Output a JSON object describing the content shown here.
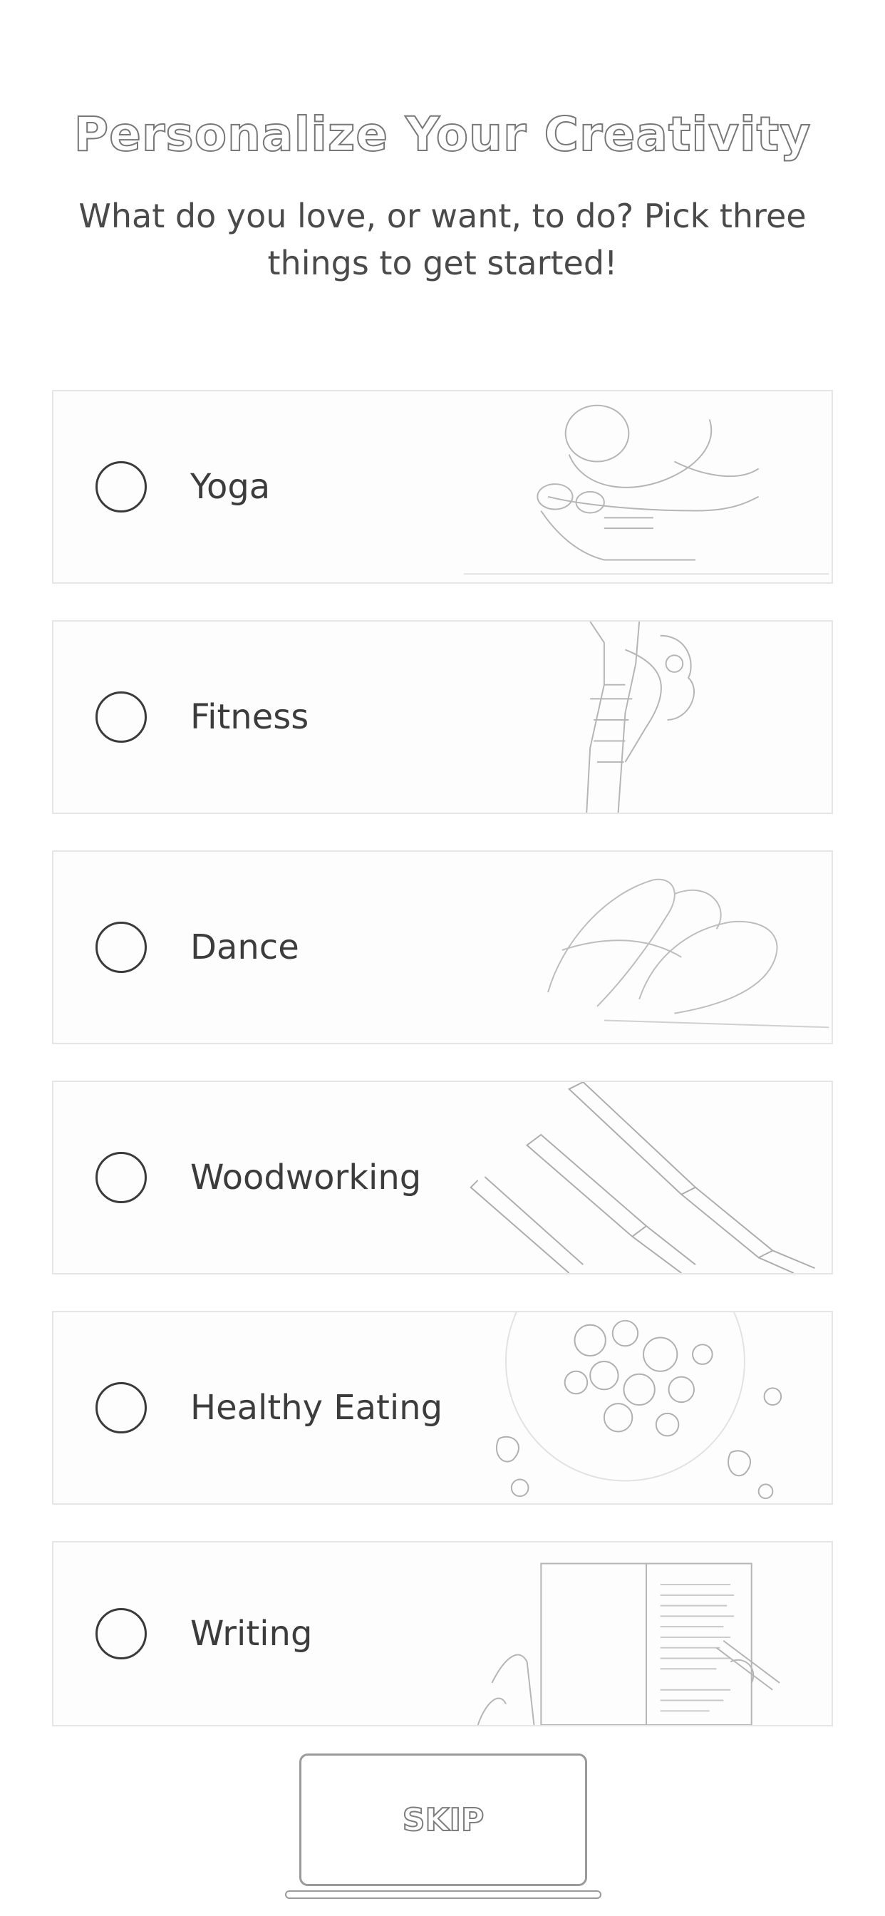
{
  "header": {
    "title": "Personalize Your Creativity",
    "subtitle": "What do you love, or want, to do? Pick three things to get started!"
  },
  "options": [
    {
      "label": "Yoga",
      "selected": false,
      "image_icon": "yoga-pose-photo"
    },
    {
      "label": "Fitness",
      "selected": false,
      "image_icon": "fitness-legs-photo"
    },
    {
      "label": "Dance",
      "selected": false,
      "image_icon": "ballet-shoes-photo"
    },
    {
      "label": "Woodworking",
      "selected": false,
      "image_icon": "chisels-photo"
    },
    {
      "label": "Healthy Eating",
      "selected": false,
      "image_icon": "fruit-bowl-photo"
    },
    {
      "label": "Writing",
      "selected": false,
      "image_icon": "notebook-writing-photo"
    }
  ],
  "footer": {
    "skip_label": "SKIP"
  }
}
